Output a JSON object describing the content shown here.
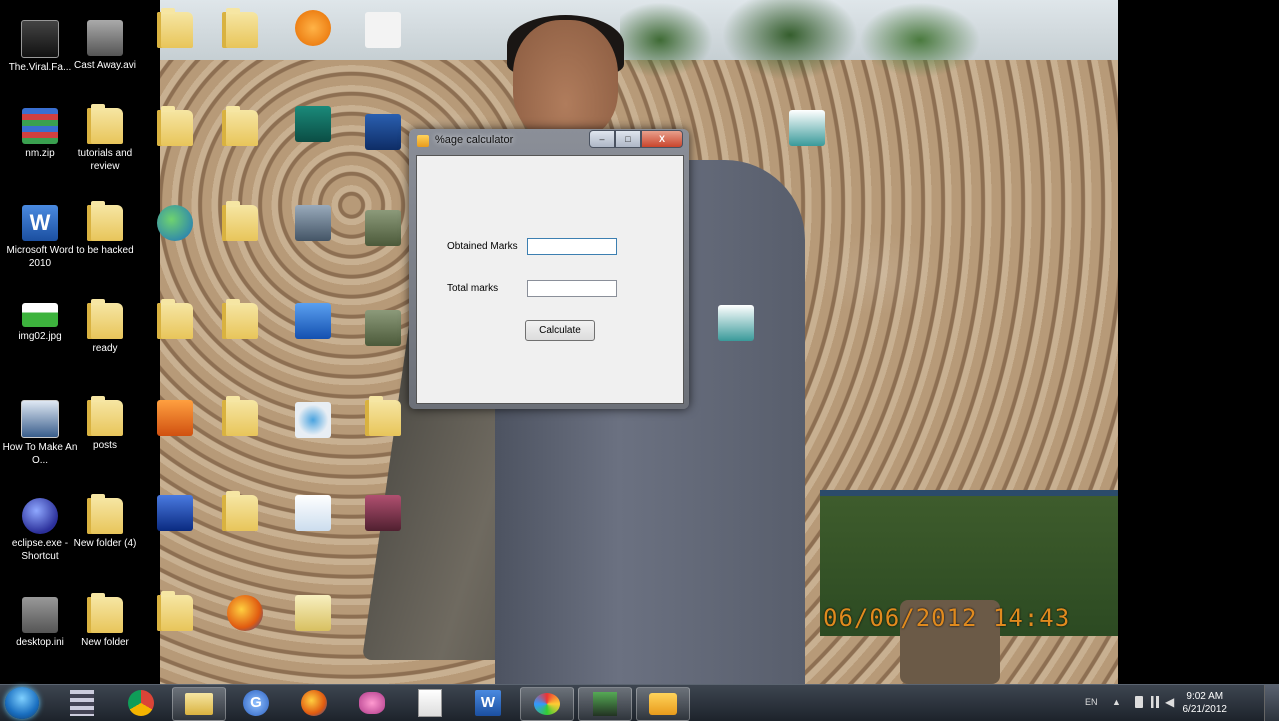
{
  "window": {
    "title": "%age calculator",
    "obtained_label": "Obtained Marks",
    "obtained_value": "",
    "total_label": "Total marks",
    "total_value": "",
    "calculate_label": "Calculate",
    "min": "–",
    "max": "□",
    "close": "X"
  },
  "desktop_icons": {
    "viral": "The.Viral.Fa...",
    "castaway": "Cast Away.avi",
    "nmzip": "nm.zip",
    "tutorials": "tutorials and review",
    "word": "Microsoft Word 2010",
    "hacked": "to be hacked",
    "img02": "img02.jpg",
    "ready": "ready",
    "howto": "How To Make An O...",
    "posts": "posts",
    "eclipse": "eclipse.exe - Shortcut",
    "newfolder4": "New folder (4)",
    "desktopini": "desktop.ini",
    "newfolder": "New folder"
  },
  "wallpaper": {
    "stamp": "06/06/2012 14:43"
  },
  "taskbar": {
    "lang": "EN",
    "time": "9:02 AM",
    "date": "6/21/2012"
  },
  "colors": {
    "taskbar": "#2b323b",
    "close_button": "#c9452c"
  }
}
